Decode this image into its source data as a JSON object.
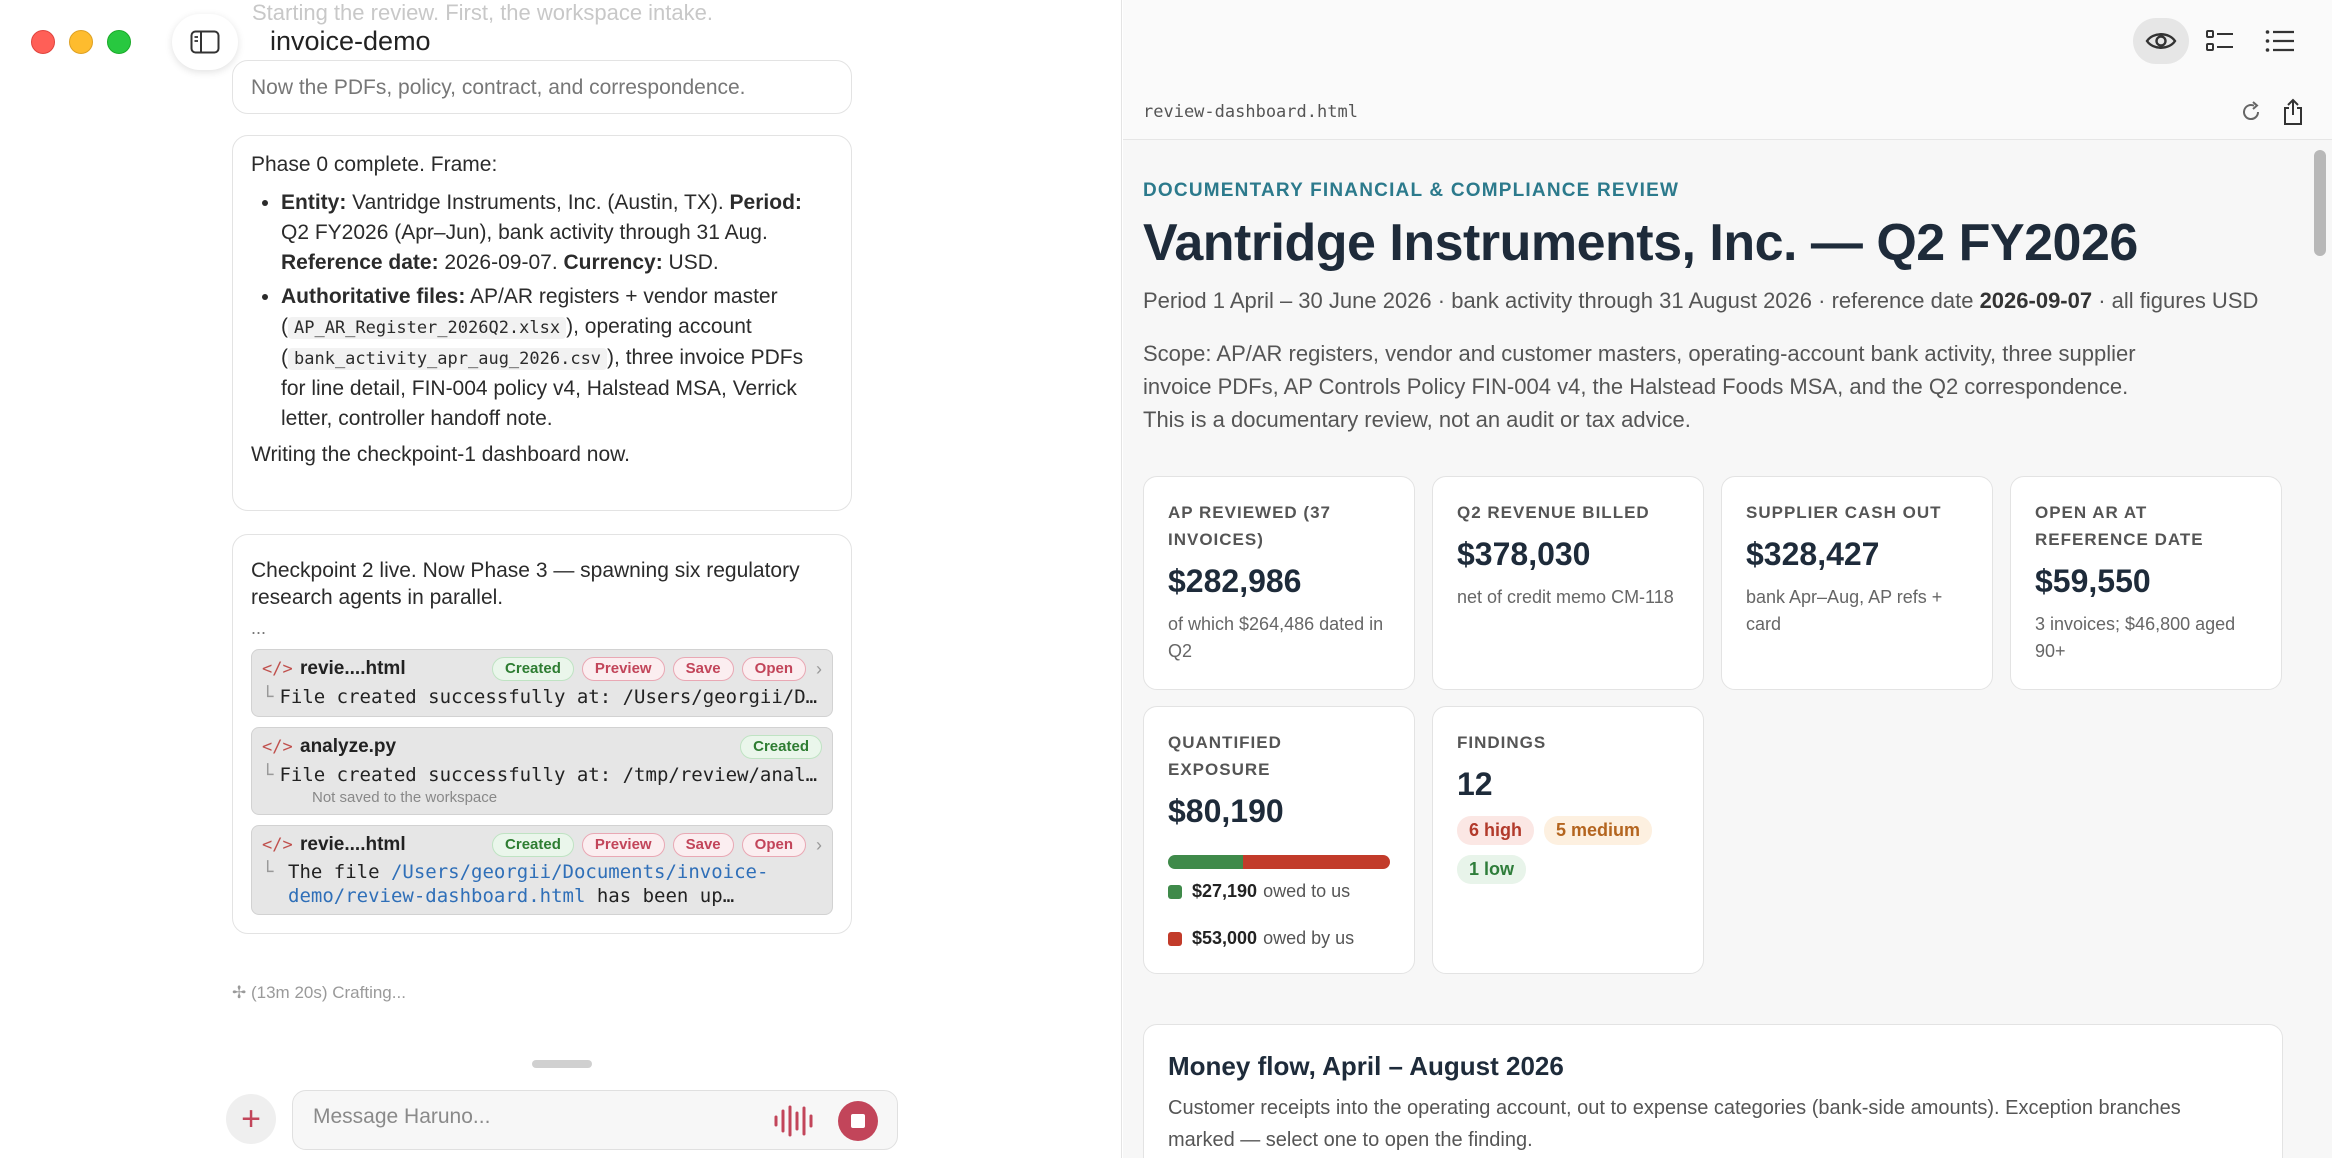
{
  "window": {
    "title": "invoice-demo"
  },
  "chat": {
    "ghost_text": "Starting the review. First, the workspace intake.",
    "msg0": "Now the PDFs, policy, contract, and correspondence.",
    "msg1": {
      "intro": "Phase 0 complete. Frame:",
      "b1_entity_label": "Entity:",
      "b1_entity": " Vantridge Instruments, Inc. (Austin, TX). ",
      "b1_period_label": "Period:",
      "b1_period": " Q2 FY2026 (Apr–Jun), bank activity through 31 Aug. ",
      "b1_ref_label": "Reference date:",
      "b1_ref": " 2026-09-07. ",
      "b1_cur_label": "Currency:",
      "b1_cur": " USD.",
      "b2_label": "Authoritative files:",
      "b2_text1": " AP/AR registers + vendor master (",
      "b2_code1": "AP_AR_Register_2026Q2.xlsx",
      "b2_text2": "), operating account (",
      "b2_code2": "bank_activity_apr_aug_2026.csv",
      "b2_text3": "), three invoice PDFs for line detail, FIN-004 policy v4, Halstead MSA, Verrick letter, controller handoff note.",
      "outro": "Writing the checkpoint-1 dashboard now."
    },
    "msg2": {
      "lead": "Checkpoint 2 live. Now Phase 3 — spawning six regulatory research agents in parallel.",
      "dots": "...",
      "tools": [
        {
          "icon": "</>",
          "name": "revie....html",
          "status": "Created",
          "actions": [
            "Preview",
            "Save",
            "Open"
          ],
          "output": "File created successfully at: /Users/georgii/Documents/invoice-demo/review-dashboard.html"
        },
        {
          "icon": "</>",
          "name": "analyze.py",
          "status": "Created",
          "output": "File created successfully at: /tmp/review/analyze.py",
          "note": "Not saved to the workspace"
        },
        {
          "icon": "</>",
          "name": "revie....html",
          "status": "Created",
          "actions": [
            "Preview",
            "Save",
            "Open"
          ],
          "output_pre": "The file ",
          "output_link": "/Users/georgii/Documents/invoice-demo/review-dashboard.html",
          "output_post": " has been up…"
        }
      ]
    },
    "crafting": "(13m 20s) Crafting...",
    "composer": {
      "placeholder": "Message Haruno..."
    }
  },
  "preview": {
    "file_name": "review-dashboard.html",
    "eyebrow": "DOCUMENTARY FINANCIAL & COMPLIANCE REVIEW",
    "title": "Vantridge Instruments, Inc. — Q2 FY2026",
    "period_pre": "Period 1 April – 30 June 2026 · bank activity through 31 August 2026 · reference date ",
    "period_date": "2026-09-07",
    "period_post": " · all figures USD",
    "scope": "Scope: AP/AR registers, vendor and customer masters, operating-account bank activity, three supplier invoice PDFs, AP Controls Policy FIN-004 v4, the Halstead Foods MSA, and the Q2 correspondence. This is a documentary review, not an audit or tax advice.",
    "cards": [
      {
        "label": "AP REVIEWED (37 INVOICES)",
        "value": "$282,986",
        "sub": "of which $264,486 dated in Q2"
      },
      {
        "label": "Q2 REVENUE BILLED",
        "value": "$378,030",
        "sub": "net of credit memo CM-118"
      },
      {
        "label": "SUPPLIER CASH OUT",
        "value": "$328,427",
        "sub": "bank Apr–Aug, AP refs + card"
      },
      {
        "label": "OPEN AR AT REFERENCE DATE",
        "value": "$59,550",
        "sub": "3 invoices; $46,800 aged 90+"
      }
    ],
    "exposure": {
      "label": "QUANTIFIED EXPOSURE",
      "value": "$80,190",
      "owed_us_value": "$27,190",
      "owed_us_text": "owed to us",
      "owed_by_value": "$53,000",
      "owed_by_text": "owed by us",
      "owed_us_fraction": 0.339,
      "owed_us_color": "#3f8a4a",
      "owed_by_color": "#c23b2a"
    },
    "findings": {
      "label": "FINDINGS",
      "value": "12",
      "high": "6 high",
      "medium": "5 medium",
      "low": "1 low"
    },
    "money_flow": {
      "title": "Money flow, April – August 2026",
      "desc": "Customer receipts into the operating account, out to expense categories (bank-side amounts). Exception branches marked — select one to open the finding."
    }
  }
}
